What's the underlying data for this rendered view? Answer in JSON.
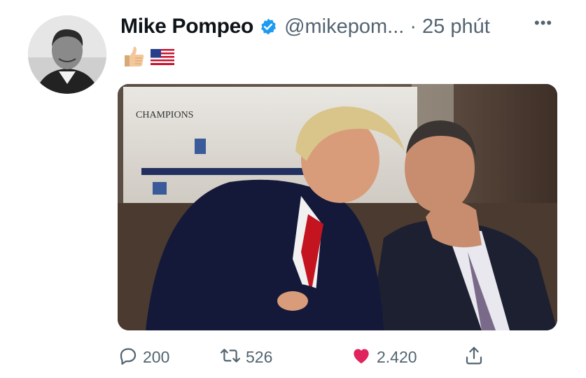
{
  "author": {
    "name": "Mike Pompeo",
    "handle": "@mikepom...",
    "separator": "·",
    "time": "25 phút",
    "verified": true,
    "avatar_icon": "profile-photo"
  },
  "tweet": {
    "emojis": [
      "thumbs-up-icon",
      "us-flag-icon"
    ],
    "media": {
      "kind": "photo",
      "sign_text": "CHAMPIONS"
    }
  },
  "actions": {
    "reply_count": "200",
    "retweet_count": "526",
    "like_count": "2.420",
    "like_color": "#e0245e",
    "icon_color": "#536471"
  },
  "more_label": "•••"
}
